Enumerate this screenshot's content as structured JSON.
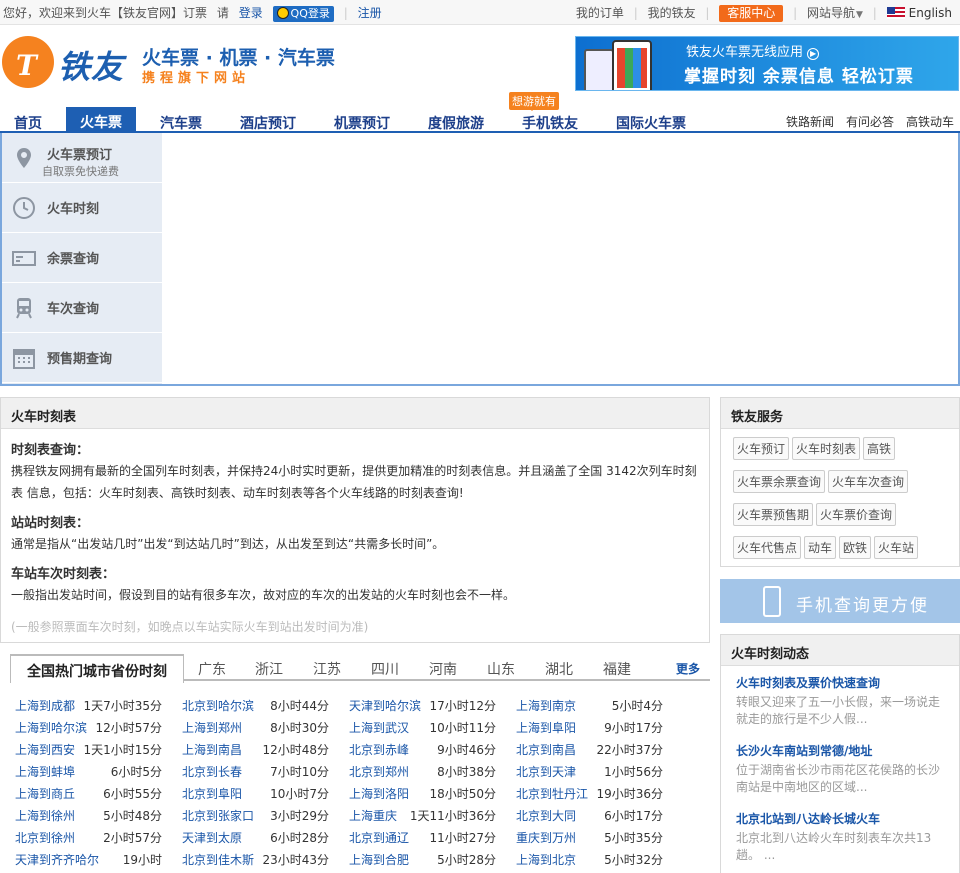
{
  "topbar": {
    "greeting": "您好，欢迎来到火车【铁友官网】订票",
    "please": "请",
    "login": "登录",
    "qq_login": "QQ登录",
    "register": "注册",
    "my_orders": "我的订单",
    "my_tieyou": "我的铁友",
    "customer_service": "客服中心",
    "site_nav": "网站导航",
    "language": "English"
  },
  "header": {
    "logo_text": "铁友",
    "slogan_main": "火车票 · 机票 · 汽车票",
    "slogan_sub": "携程旗下网站",
    "banner_line1": "铁友火车票无线应用",
    "banner_line2": "掌握时刻  余票信息  轻松订票"
  },
  "nav": {
    "items": [
      "首页",
      "火车票",
      "汽车票",
      "酒店预订",
      "机票预订",
      "度假旅游",
      "手机铁友",
      "国际火车票"
    ],
    "badge": "想游就有",
    "right_links": [
      "铁路新闻",
      "有问必答",
      "高铁动车"
    ]
  },
  "side_tabs": [
    {
      "label": "火车票预订",
      "sub": "自取票免快递费",
      "icon": "location-pin-icon"
    },
    {
      "label": "火车时刻",
      "sub": "",
      "icon": "clock-icon"
    },
    {
      "label": "余票查询",
      "sub": "",
      "icon": "ticket-icon"
    },
    {
      "label": "车次查询",
      "sub": "",
      "icon": "train-icon"
    },
    {
      "label": "预售期查询",
      "sub": "",
      "icon": "calendar-icon"
    }
  ],
  "timetable": {
    "title": "火车时刻表",
    "s1_title": "时刻表查询：",
    "s1_text": "携程铁友网拥有最新的全国列车时刻表，并保持24小时实时更新，提供更加精准的时刻表信息。并且涵盖了全国 3142次列车时刻表 信息，包括：火车时刻表、高铁时刻表、动车时刻表等各个火车线路的时刻表查询!",
    "s2_title": "站站时刻表：",
    "s2_text": "通常是指从“出发站几时”出发“到达站几时”到达，从出发至到达“共需多长时间”。",
    "s3_title": "车站车次时刻表：",
    "s3_text": "一般指出发站时间，假设到目的站有很多车次，故对应的车次的出发站的火车时刻也会不一样。",
    "note": "(一般参照票面车次时刻，如晚点以车站实际火车到站出发时间为准)"
  },
  "city_tabs": {
    "active": "全国热门城市省份时刻",
    "items": [
      "广东",
      "浙江",
      "江苏",
      "四川",
      "河南",
      "山东",
      "湖北",
      "福建"
    ],
    "more": "更多"
  },
  "routes": [
    [
      [
        "上海到成都",
        "1天7小时35分"
      ],
      [
        "北京到哈尔滨",
        "8小时44分"
      ],
      [
        "天津到哈尔滨",
        "17小时12分"
      ],
      [
        "上海到南京",
        "5小时4分"
      ]
    ],
    [
      [
        "上海到哈尔滨",
        "12小时57分"
      ],
      [
        "上海到郑州",
        "8小时30分"
      ],
      [
        "上海到武汉",
        "10小时11分"
      ],
      [
        "上海到阜阳",
        "9小时17分"
      ]
    ],
    [
      [
        "上海到西安",
        "1天1小时15分"
      ],
      [
        "上海到南昌",
        "12小时48分"
      ],
      [
        "北京到赤峰",
        "9小时46分"
      ],
      [
        "北京到南昌",
        "22小时37分"
      ]
    ],
    [
      [
        "上海到蚌埠",
        "6小时5分"
      ],
      [
        "北京到长春",
        "7小时10分"
      ],
      [
        "北京到郑州",
        "8小时38分"
      ],
      [
        "北京到天津",
        "1小时56分"
      ]
    ],
    [
      [
        "上海到商丘",
        "6小时55分"
      ],
      [
        "北京到阜阳",
        "10小时7分"
      ],
      [
        "上海到洛阳",
        "18小时50分"
      ],
      [
        "北京到牡丹江",
        "19小时36分"
      ]
    ],
    [
      [
        "上海到徐州",
        "5小时48分"
      ],
      [
        "北京到张家口",
        "3小时29分"
      ],
      [
        "上海重庆",
        "1天11小时36分"
      ],
      [
        "北京到大同",
        "6小时17分"
      ]
    ],
    [
      [
        "北京到徐州",
        "2小时57分"
      ],
      [
        "天津到太原",
        "6小时28分"
      ],
      [
        "北京到通辽",
        "11小时27分"
      ],
      [
        "重庆到万州",
        "5小时35分"
      ]
    ],
    [
      [
        "天津到齐齐哈尔",
        "19小时"
      ],
      [
        "北京到佳木斯",
        "23小时43分"
      ],
      [
        "上海到合肥",
        "5小时28分"
      ],
      [
        "上海到北京",
        "5小时32分"
      ]
    ]
  ],
  "services": {
    "title": "铁友服务",
    "chips": [
      "火车预订",
      "火车时刻表",
      "高铁",
      "火车票余票查询",
      "火车车次查询",
      "火车票预售期",
      "火车票价查询",
      "火车代售点",
      "动车",
      "欧铁",
      "火车站"
    ]
  },
  "mobile_banner": "手机查询更方便",
  "news": {
    "title": "火车时刻动态",
    "items": [
      {
        "title": "火车时刻表及票价快速查询",
        "desc": "转眼又迎来了五一小长假，来一场说走就走的旅行是不少人假..."
      },
      {
        "title": "长沙火车南站到常德/地址",
        "desc": "位于湖南省长沙市雨花区花侯路的长沙南站是中南地区的区域..."
      },
      {
        "title": "北京北站到八达岭长城火车",
        "desc": "北京北到八达岭火车时刻表车次共13趟。 ..."
      }
    ]
  },
  "colors": {
    "brand_blue": "#1e5fb3",
    "brand_orange": "#f5821f",
    "link": "#1a56a8"
  }
}
